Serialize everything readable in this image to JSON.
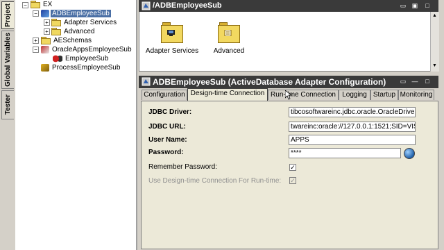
{
  "side_tabs": [
    "Project",
    "Global Variables",
    "Tester"
  ],
  "tree": {
    "root": "EX",
    "items": [
      {
        "label": "ADBEmployeeSub",
        "selected": true
      },
      {
        "label": "Adapter Services"
      },
      {
        "label": "Advanced"
      },
      {
        "label": "AESchemas"
      },
      {
        "label": "OracleAppsEmployeeSub"
      },
      {
        "label": "EmployeeSub"
      },
      {
        "label": "ProcessEmployeeSub"
      }
    ]
  },
  "top_panel": {
    "title": "/ADBEmployeeSub",
    "icons": [
      {
        "label": "Adapter Services"
      },
      {
        "label": "Advanced"
      }
    ]
  },
  "bottom_panel": {
    "title": "ADBEmployeeSub (ActiveDatabase Adapter Configuration)",
    "tabs": [
      "Configuration",
      "Design-time Connection",
      "Run-time Connection",
      "Logging",
      "Startup",
      "Monitoring"
    ],
    "active_tab": "Design-time Connection",
    "fields": {
      "jdbc_driver_label": "JDBC Driver:",
      "jdbc_driver_value": "tibcosoftwareinc.jdbc.oracle.OracleDriver",
      "jdbc_url_label": "JDBC URL:",
      "jdbc_url_value": "twareinc:oracle://127.0.0.1:1521;SID=VIS",
      "user_name_label": "User Name:",
      "user_name_value": "APPS",
      "password_label": "Password:",
      "password_value": "****",
      "remember_password_label": "Remember Password:",
      "remember_password_checked": true,
      "use_designtime_label": "Use Design-time Connection For Run-time:",
      "use_designtime_checked": true
    }
  },
  "colors": {
    "panel_header": "#3a3a3a",
    "selection": "#4a6fa5",
    "folder": "#f0d860"
  }
}
